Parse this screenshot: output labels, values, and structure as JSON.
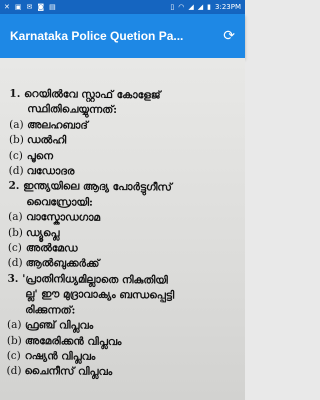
{
  "status_bar": {
    "left_icons": [
      "close-icon",
      "image-icon",
      "mail-icon",
      "message-icon",
      "screenshot-icon"
    ],
    "time": "3:23PM",
    "battery": "",
    "icons": [
      "vibrate-icon",
      "wifi-icon",
      "signal-icon",
      "signal-icon",
      "battery-icon"
    ]
  },
  "app_bar": {
    "title": "Karnataka Police Quetion Pa...",
    "refresh_icon": "refresh-icon"
  },
  "questions": [
    {
      "line1": "1. റെയിൽവേ സ്റ്റാഫ് കോളേജ്",
      "line2": "സ്ഥിതിചെയ്യുന്നത്:",
      "options": [
        {
          "label": "(a)",
          "text": "അലഹബാദ്"
        },
        {
          "label": "(b)",
          "text": "ഡൽഹി"
        },
        {
          "label": "(c)",
          "text": "പൂനെ"
        },
        {
          "label": "(d)",
          "text": "വഡോദര"
        }
      ]
    },
    {
      "line1": "2. ഇന്ത്യയിലെ ആദ്യ പോർട്ടുഗീസ്",
      "line2": "വൈസ്രോയി:",
      "options": [
        {
          "label": "(a)",
          "text": "വാസ്കോഡഗാമ"
        },
        {
          "label": "(b)",
          "text": "ഡ്യൂപ്ലെ"
        },
        {
          "label": "(c)",
          "text": "അൽമേഡ"
        },
        {
          "label": "(d)",
          "text": "ആൽബുക്കർക്ക്"
        }
      ]
    },
    {
      "line1": "3. 'പ്രാതിനിധ്യമില്ലാതെ നികുതിയി",
      "line2": "ല്ല' ഈ മുദ്രാവാക്യം ബന്ധപ്പെട്ടി",
      "line3": "രിക്കുന്നത്:",
      "options": [
        {
          "label": "(a)",
          "text": "ഫ്രഞ്ച് വിപ്ലവം"
        },
        {
          "label": "(b)",
          "text": "അമേരിക്കൻ വിപ്ലവം"
        },
        {
          "label": "(c)",
          "text": "റഷ്യൻ വിപ്ലവം"
        },
        {
          "label": "(d)",
          "text": "ചൈനീസ് വിപ്ലവം"
        }
      ]
    }
  ]
}
